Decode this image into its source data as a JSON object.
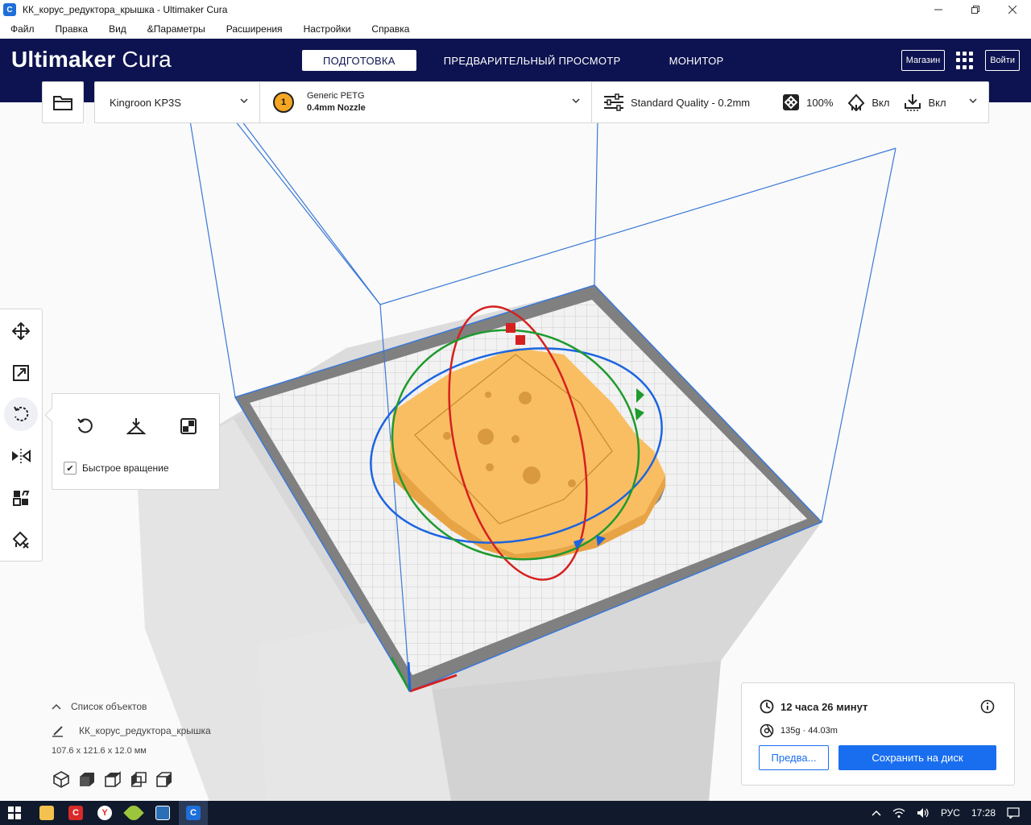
{
  "window": {
    "title": "КК_корус_редуктора_крышка - Ultimaker Cura",
    "app_icon_letter": "C"
  },
  "menu": [
    "Файл",
    "Правка",
    "Вид",
    "&Параметры",
    "Расширения",
    "Настройки",
    "Справка"
  ],
  "header": {
    "logo_bold": "Ultimaker",
    "logo_light": " Cura",
    "tabs": [
      "ПОДГОТОВКА",
      "ПРЕДВАРИТЕЛЬНЫЙ ПРОСМОТР",
      "МОНИТОР"
    ],
    "active_tab": "ПОДГОТОВКА",
    "marketplace": "Магазин",
    "signin": "Войти"
  },
  "config": {
    "printer": "Kingroon KP3S",
    "extruder_number": "1",
    "material": "Generic PETG",
    "nozzle": "0.4mm Nozzle",
    "profile": "Standard Quality - 0.2mm",
    "infill": "100%",
    "support": "Вкл",
    "adhesion": "Вкл"
  },
  "rotate_panel": {
    "fast_rotate_label": "Быстрое вращение",
    "fast_rotate_checked": true
  },
  "objects": {
    "toggle_label": "Список объектов",
    "name": "КК_корус_редуктора_крышка",
    "dimensions": "107.6 x 121.6 x 12.0 мм"
  },
  "print": {
    "time": "12 часа 26 минут",
    "material_usage": "135g · 44.03m",
    "preview_button": "Предва...",
    "save_button": "Сохранить на диск"
  },
  "taskbar": {
    "language": "РУС",
    "clock": "17:28"
  },
  "colors": {
    "header_bg": "#0d1350",
    "accent_blue": "#196ef0",
    "model_orange": "#f9be62",
    "rotate_x": "#d62020",
    "rotate_y": "#1f9a2e",
    "rotate_z": "#1c64e0"
  }
}
